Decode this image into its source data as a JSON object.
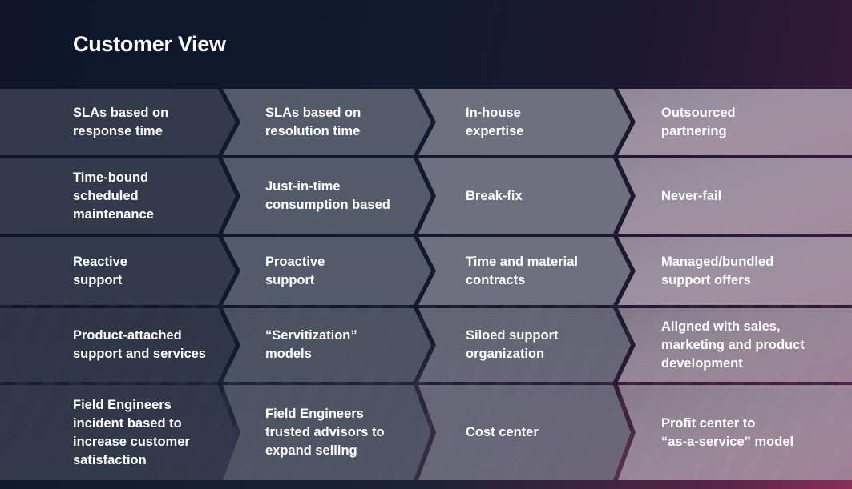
{
  "title": "Customer View",
  "colors": {
    "background": "#0e1628",
    "divider": "#101a2d",
    "column_fills": [
      "#333a4b",
      "#535a69",
      "#6e7080",
      "#8f8595"
    ],
    "accent_pink": "#c98ea8",
    "text": "#ffffff"
  },
  "rows": [
    {
      "cells": [
        "SLAs based on\nresponse time",
        "SLAs based on\nresolution time",
        "In-house\nexpertise",
        "Outsourced\npartnering"
      ]
    },
    {
      "cells": [
        "Time-bound\nscheduled\nmaintenance",
        "Just-in-time\nconsumption based",
        "Break-fix",
        "Never-fail"
      ]
    },
    {
      "cells": [
        "Reactive\nsupport",
        "Proactive\nsupport",
        "Time and material\ncontracts",
        "Managed/bundled\nsupport offers"
      ]
    },
    {
      "cells": [
        "Product-attached\nsupport and services",
        "“Servitization”\nmodels",
        "Siloed support\norganization",
        "Aligned with sales,\nmarketing and product\ndevelopment"
      ]
    },
    {
      "cells": [
        "Field Engineers\nincident based to\nincrease customer\nsatisfaction",
        "Field Engineers\ntrusted advisors to\nexpand selling",
        "Cost center",
        "Profit center to\n“as-a-service” model"
      ]
    }
  ]
}
